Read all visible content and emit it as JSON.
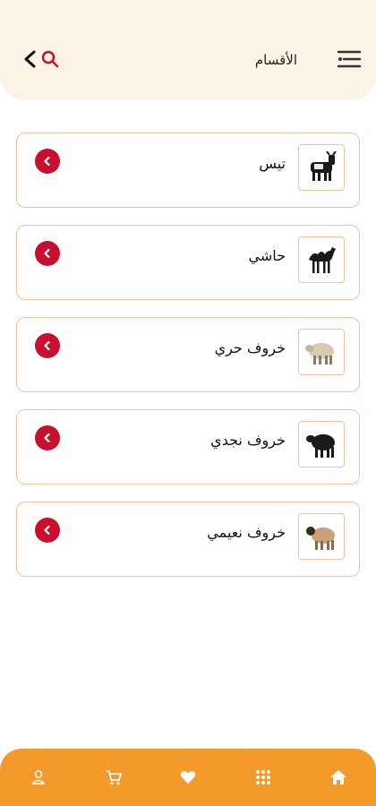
{
  "header": {
    "title": "الأقسام",
    "menu_icon": "menu-icon",
    "search_icon": "search-icon",
    "back_icon": "chevron-left-icon"
  },
  "categories": [
    {
      "label": "تيس",
      "image": "goat-image"
    },
    {
      "label": "حاشي",
      "image": "camel-image"
    },
    {
      "label": "خروف حري",
      "image": "sheep-white-image"
    },
    {
      "label": "خروف نجدي",
      "image": "sheep-black-image"
    },
    {
      "label": "خروف نعيمي",
      "image": "sheep-brown-image"
    }
  ],
  "bottom_nav": [
    {
      "icon": "user-icon"
    },
    {
      "icon": "cart-icon"
    },
    {
      "icon": "heart-icon"
    },
    {
      "icon": "grid-icon"
    },
    {
      "icon": "home-icon"
    }
  ],
  "colors": {
    "accent": "#f39a2a",
    "header_bg": "#fbf3e6",
    "chevron": "#c8102e",
    "card_border": "#f3c39b"
  }
}
